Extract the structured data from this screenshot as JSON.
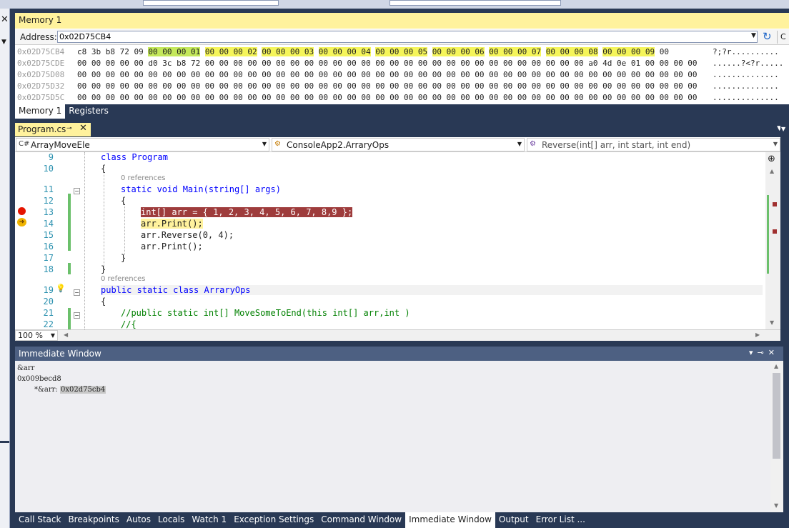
{
  "memory": {
    "title": "Memory 1",
    "address_label": "Address:",
    "address_value": "0x02D75CB4",
    "rows": [
      {
        "addr": "0x02D75CB4",
        "ascii": "?;?r.........."
      },
      {
        "addr": "0x02D75CDE",
        "ascii": "......?<?r....."
      },
      {
        "addr": "0x02D75D08",
        "ascii": ".............."
      },
      {
        "addr": "0x02D75D32",
        "ascii": ".............."
      },
      {
        "addr": "0x02D75D5C",
        "ascii": ".............."
      }
    ],
    "row0_prefix": "c8 3b b8 72 09 ",
    "row0_groups": [
      "00 00 00 01",
      "00 00 00 02",
      "00 00 00 03",
      "00 00 00 04",
      "00 00 00 05",
      "00 00 00 06",
      "00 00 00 07",
      "00 00 00 08",
      "00 00 00 09"
    ],
    "row0_suffix": " 00",
    "row1_bytes": "00 00 00 00 00 d0 3c b8 72 00 00 00 00 00 00 00 00 00 00 00 00 00 00 00 00 00 00 00 00 00 00 00 00 00 00 00 a0 4d 0e 01 00 00 00 00",
    "row_zero_bytes": "00 00 00 00 00 00 00 00 00 00 00 00 00 00 00 00 00 00 00 00 00 00 00 00 00 00 00 00 00 00 00 00 00 00 00 00 00 00 00 00 00 00 00 00",
    "tabs": [
      "Memory 1",
      "Registers"
    ],
    "refresh_icon": "refresh-icon"
  },
  "editor": {
    "tab_label": "Program.cs",
    "nav_project": "ArrayMoveEle",
    "nav_class": "ConsoleApp2.ArraryOps",
    "nav_member": "Reverse(int[] arr, int start, int end)",
    "zoom": "100 %",
    "refs_label": "0 references",
    "lines": [
      {
        "n": "9",
        "text": "class Program"
      },
      {
        "n": "10",
        "text": "{"
      },
      {
        "n": "11",
        "text": "static void Main(string[] args)"
      },
      {
        "n": "12",
        "text": "{"
      },
      {
        "n": "13",
        "text": "int[] arr = { 1, 2, 3, 4, 5, 6, 7, 8,9 };"
      },
      {
        "n": "14",
        "text": "arr.Print();"
      },
      {
        "n": "15",
        "text": "arr.Reverse(0, 4);"
      },
      {
        "n": "16",
        "text": "arr.Print();"
      },
      {
        "n": "17",
        "text": "}"
      },
      {
        "n": "18",
        "text": "}"
      },
      {
        "n": "19",
        "text": "public static class ArraryOps"
      },
      {
        "n": "20",
        "text": "{"
      },
      {
        "n": "21",
        "text": "//public static int[] MoveSomeToEnd(this int[] arr,int )"
      },
      {
        "n": "22",
        "text": "//{"
      }
    ]
  },
  "immediate": {
    "title": "Immediate Window",
    "lines": [
      "&arr",
      "0x009becd8"
    ],
    "deref_label": "*&arr: ",
    "deref_value": "0x02d75cb4"
  },
  "bottom_tabs": [
    "Call Stack",
    "Breakpoints",
    "Autos",
    "Locals",
    "Watch 1",
    "Exception Settings",
    "Command Window",
    "Immediate Window",
    "Output",
    "Error List ..."
  ],
  "active_bottom_tab": "Immediate Window",
  "colors": {
    "breakpoint": "#e51400",
    "highlight": "#fff29d",
    "tab_bar": "#293955"
  }
}
